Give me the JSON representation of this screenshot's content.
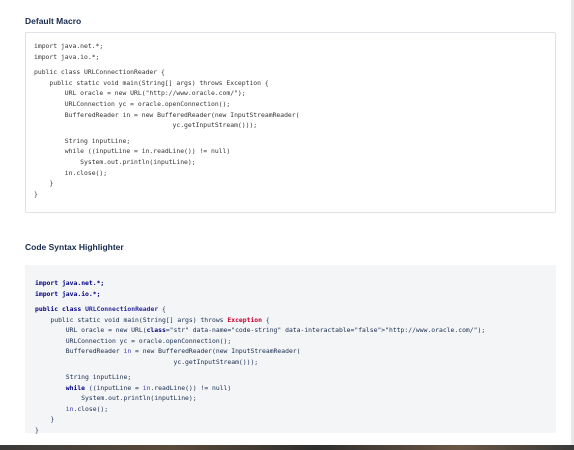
{
  "sections": [
    {
      "title": "Default Macro",
      "lines": [
        "import java.net.*;",
        "import java.io.*;",
        "",
        "public class URLConnectionReader {",
        "    public static void main(String[] args) throws Exception {",
        "        URL oracle = new URL(\"http://www.oracle.com/\");",
        "        URLConnection yc = oracle.openConnection();",
        "        BufferedReader in = new BufferedReader(new InputStreamReader(",
        "                                    yc.getInputStream()));",
        "        String inputLine;",
        "        while ((inputLine = in.readLine()) != null)",
        "            System.out.println(inputLine);",
        "        in.close();",
        "    }",
        "}"
      ]
    },
    {
      "title": "Code Syntax Highlighter",
      "lines": [
        "import java.net.*;",
        "import java.io.*;",
        "",
        "public class URLConnectionReader {",
        "    public static void main(String[] args) throws Exception {",
        "        URL oracle = new URL(\"http://www.oracle.com/\");",
        "        URLConnection yc = oracle.openConnection();",
        "        BufferedReader in = new BufferedReader(new InputStreamReader(",
        "                                    yc.getInputStream()));",
        "        String inputLine;",
        "        while ((inputLine = in.readLine()) != null)",
        "            System.out.println(inputLine);",
        "        in.close();",
        "    }",
        "}"
      ]
    }
  ],
  "colors": {
    "keyword": "#000080",
    "string": "#d04437",
    "exception": "#c8002d",
    "panel_background": "#f4f5f7",
    "panel_border": "#dfe1e6"
  }
}
